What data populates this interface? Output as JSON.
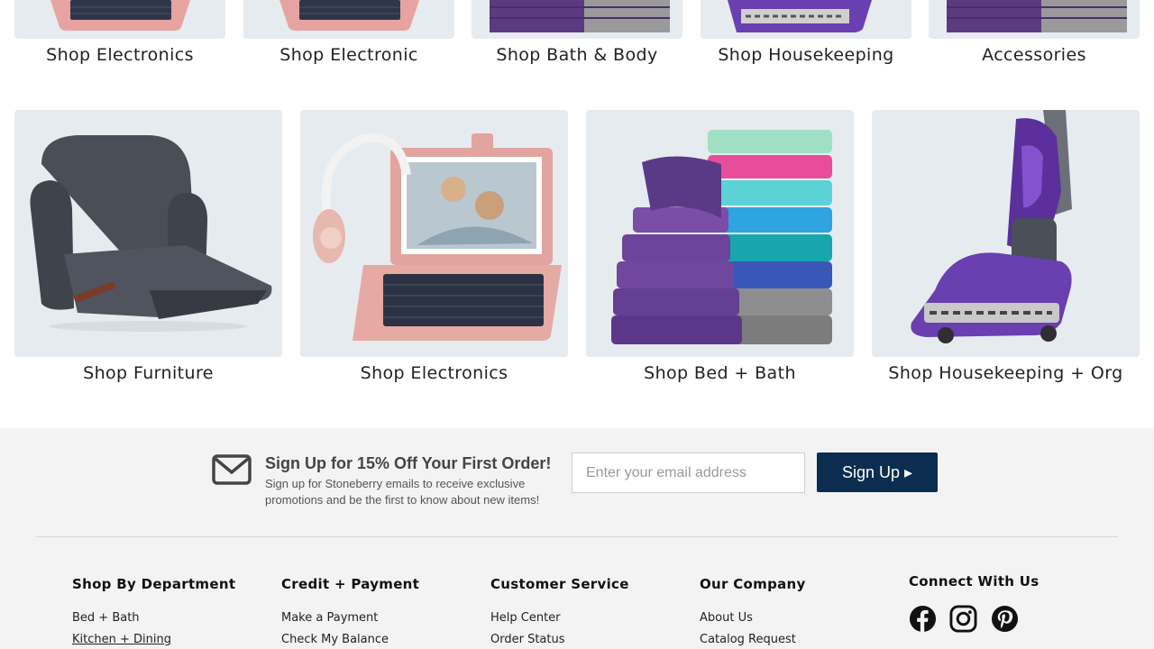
{
  "top_row": {
    "labels": [
      "Shop Electronics",
      "Shop Electronic",
      "Shop Bath & Body",
      "Shop Housekeeping",
      "Accessories"
    ]
  },
  "categories": {
    "labels": [
      "Shop Furniture",
      "Shop Electronics",
      "Shop Bed + Bath",
      "Shop Housekeeping + Org"
    ]
  },
  "signup": {
    "icon": "envelope-icon",
    "title": "Sign Up for 15% Off Your First Order!",
    "text": "Sign up for Stoneberry emails to receive exclusive promotions and be the first to know about new items!",
    "email_placeholder": "Enter your email address",
    "button_label": "Sign Up ▸"
  },
  "footer_columns": [
    {
      "title": "Shop By Department",
      "links": [
        "Bed + Bath",
        "Kitchen + Dining"
      ]
    },
    {
      "title": "Credit + Payment",
      "links": [
        "Make a Payment",
        "Check My Balance"
      ]
    },
    {
      "title": "Customer Service",
      "links": [
        "Help Center",
        "Order Status"
      ]
    },
    {
      "title": "Our Company",
      "links": [
        "About Us",
        "Catalog Request"
      ]
    }
  ],
  "social": {
    "title": "Connect With Us",
    "icons": [
      "facebook-icon",
      "instagram-icon",
      "pinterest-icon"
    ]
  },
  "colors": {
    "button_bg": "#0b2d4f",
    "footer_bg": "#f3f3f3",
    "tile_bg": "#e6ebef"
  }
}
